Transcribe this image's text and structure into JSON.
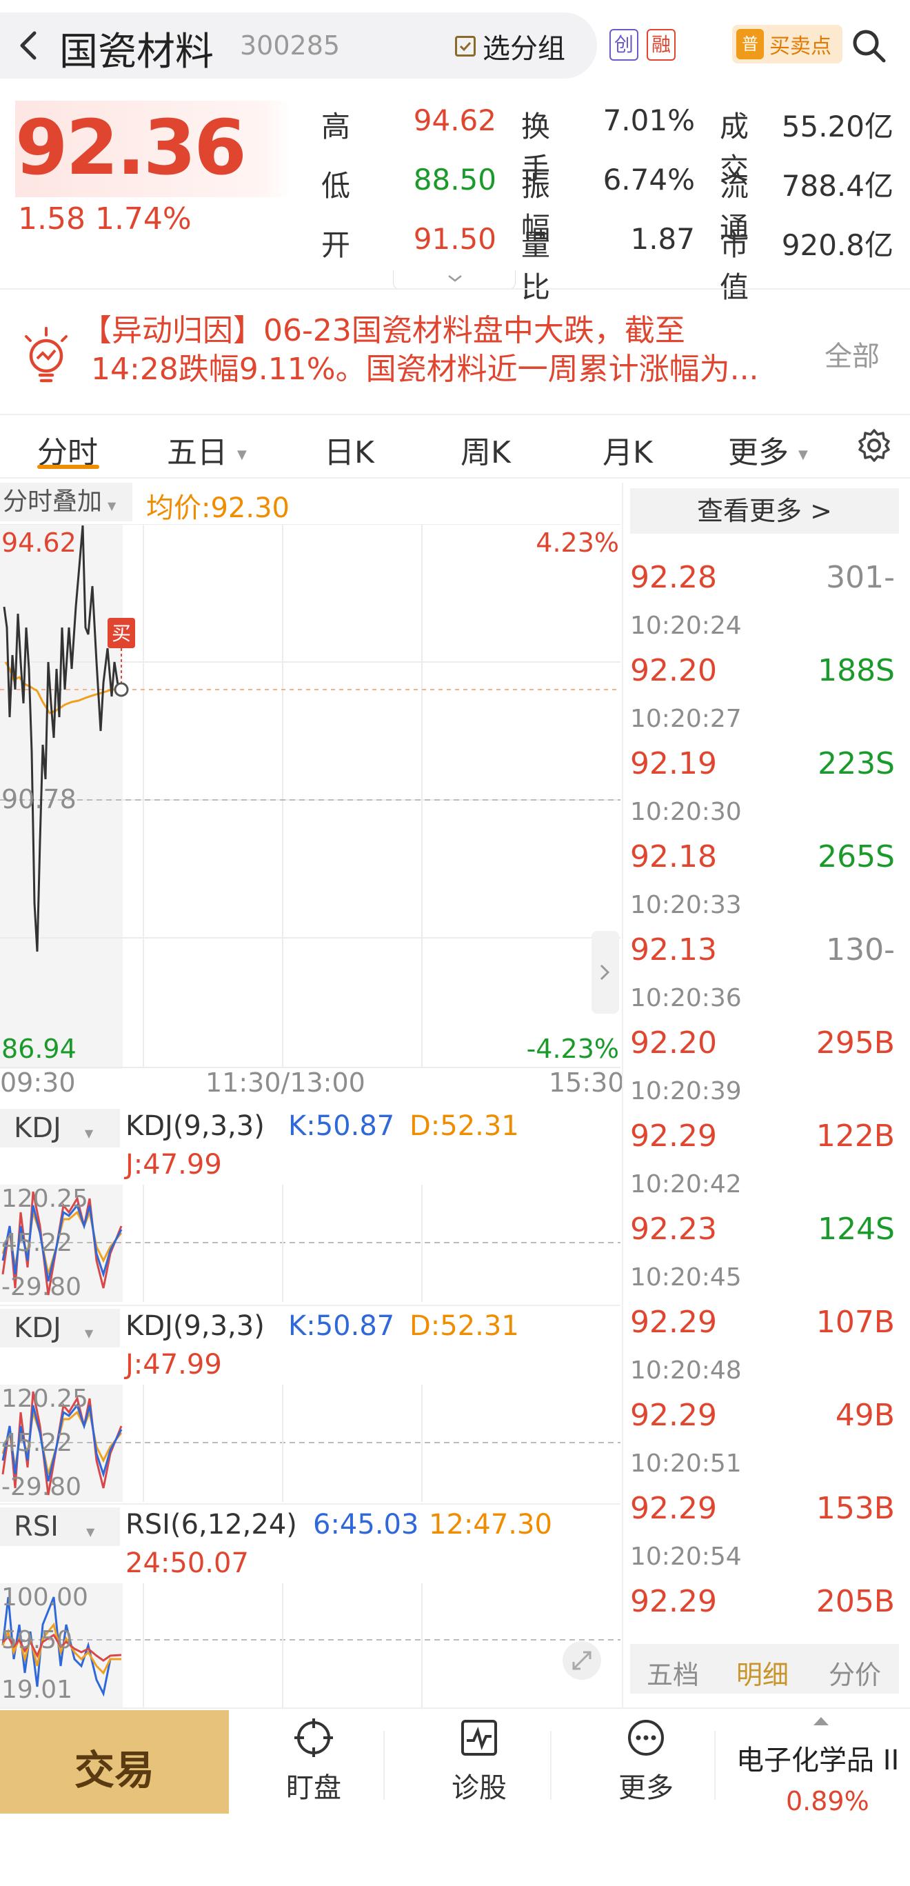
{
  "header": {
    "stock_name": "国瓷材料",
    "stock_code": "300285",
    "group_btn": "选分组",
    "badge_chuang": "创",
    "badge_rong": "融",
    "buysell_icon": "普",
    "buysell_label": "买卖点"
  },
  "quote": {
    "price": "92.36",
    "change": "1.58  1.74%",
    "rows": [
      {
        "l1": "高",
        "v1": "94.62",
        "l2": "换手",
        "v2": "7.01%",
        "l3": "成交",
        "v3": "55.20亿"
      },
      {
        "l1": "低",
        "v1": "88.50",
        "l2": "振幅",
        "v2": "6.74%",
        "l3": "流通",
        "v3": "788.4亿"
      },
      {
        "l1": "开",
        "v1": "91.50",
        "l2": "量比",
        "v2": "1.87",
        "l3": "市值",
        "v3": "920.8亿"
      }
    ]
  },
  "news": {
    "line1": "【异动归因】06-23国瓷材料盘中大跌，截至",
    "line2": "14:28跌幅9.11%。国瓷材料近一周累计涨幅为...",
    "all_label": "全部"
  },
  "tabs": [
    "分时",
    "五日",
    "日K",
    "周K",
    "月K",
    "更多"
  ],
  "chart": {
    "overlay_label": "分时叠加",
    "avg_label": "均价:92.30",
    "y_max": "94.62",
    "y_mid": "90.78",
    "y_min": "86.94",
    "pct_max": "4.23%",
    "pct_min": "-4.23%",
    "buy_marker": "买",
    "time_start": "09:30",
    "time_mid": "11:30/13:00",
    "time_end": "15:30"
  },
  "indicators": [
    {
      "tag": "KDJ",
      "title": "KDJ(9,3,3)",
      "k": "K:50.87",
      "d": "D:52.31",
      "j": "J:47.99",
      "ymax": "120.25",
      "ymid": "45.22",
      "ymin": "-29.80"
    },
    {
      "tag": "KDJ",
      "title": "KDJ(9,3,3)",
      "k": "K:50.87",
      "d": "D:52.31",
      "j": "J:47.99",
      "ymax": "120.25",
      "ymid": "45.22",
      "ymin": "-29.80"
    },
    {
      "tag": "RSI",
      "title": "RSI(6,12,24)",
      "k": "6:45.03",
      "d": "12:47.30",
      "j": "24:50.07",
      "ymax": "100.00",
      "ymid": "59.50",
      "ymin": "19.01"
    }
  ],
  "trades": {
    "more_label": "查看更多 >",
    "rows": [
      {
        "time": "",
        "price": "92.28",
        "vol": "301-",
        "dir": "neutral"
      },
      {
        "time": "10:20:24",
        "price": "92.20",
        "vol": "188S",
        "dir": "sell"
      },
      {
        "time": "10:20:27",
        "price": "92.19",
        "vol": "223S",
        "dir": "sell"
      },
      {
        "time": "10:20:30",
        "price": "92.18",
        "vol": "265S",
        "dir": "sell"
      },
      {
        "time": "10:20:33",
        "price": "92.13",
        "vol": "130-",
        "dir": "neutral"
      },
      {
        "time": "10:20:36",
        "price": "92.20",
        "vol": "295B",
        "dir": "buy"
      },
      {
        "time": "10:20:39",
        "price": "92.29",
        "vol": "122B",
        "dir": "buy"
      },
      {
        "time": "10:20:42",
        "price": "92.23",
        "vol": "124S",
        "dir": "sell"
      },
      {
        "time": "10:20:45",
        "price": "92.29",
        "vol": "107B",
        "dir": "buy"
      },
      {
        "time": "10:20:48",
        "price": "92.29",
        "vol": "49B",
        "dir": "buy"
      },
      {
        "time": "10:20:51",
        "price": "92.29",
        "vol": "153B",
        "dir": "buy"
      },
      {
        "time": "10:20:54",
        "price": "92.29",
        "vol": "205B",
        "dir": "buy"
      }
    ],
    "tabs": [
      "五档",
      "明细",
      "分价"
    ]
  },
  "bottom": {
    "trade": "交易",
    "nav": [
      "盯盘",
      "诊股",
      "更多"
    ],
    "sector": "电子化学品 II",
    "sector_change": "0.89%"
  },
  "colors": {
    "up": "#e0452f",
    "down": "#1a9a2a",
    "accent": "#f08c00",
    "gold": "#e6c27a"
  }
}
